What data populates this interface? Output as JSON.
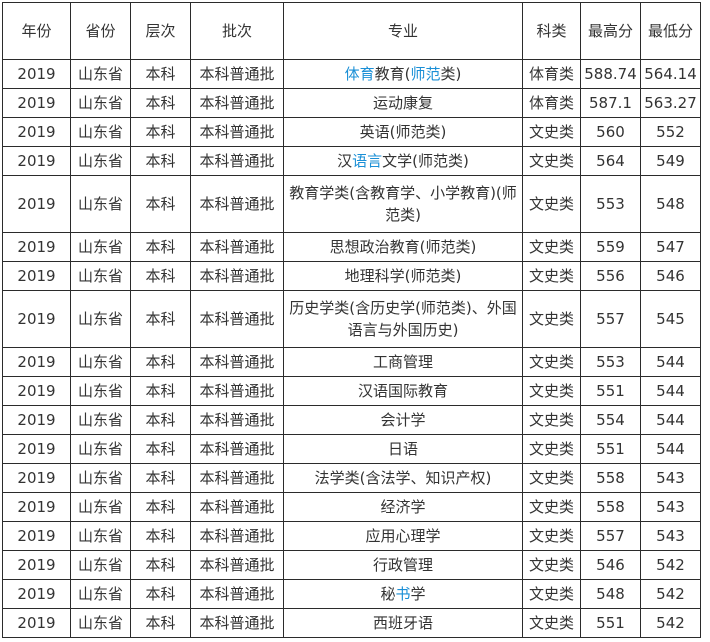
{
  "table": {
    "headers": [
      "年份",
      "省份",
      "层次",
      "批次",
      "专业",
      "科类",
      "最高分",
      "最低分"
    ],
    "rows": [
      {
        "year": "2019",
        "province": "山东省",
        "level": "本科",
        "batch": "本科普通批",
        "major": [
          {
            "t": "体育",
            "link": true
          },
          {
            "t": "教育(",
            "link": false
          },
          {
            "t": "师范",
            "link": true
          },
          {
            "t": "类)",
            "link": false
          }
        ],
        "category": "体育类",
        "max": "588.74",
        "min": "564.14"
      },
      {
        "year": "2019",
        "province": "山东省",
        "level": "本科",
        "batch": "本科普通批",
        "major": [
          {
            "t": "运动康复",
            "link": false
          }
        ],
        "category": "体育类",
        "max": "587.1",
        "min": "563.27"
      },
      {
        "year": "2019",
        "province": "山东省",
        "level": "本科",
        "batch": "本科普通批",
        "major": [
          {
            "t": "英语(师范类)",
            "link": false
          }
        ],
        "category": "文史类",
        "max": "560",
        "min": "552"
      },
      {
        "year": "2019",
        "province": "山东省",
        "level": "本科",
        "batch": "本科普通批",
        "major": [
          {
            "t": "汉",
            "link": false
          },
          {
            "t": "语言",
            "link": true
          },
          {
            "t": "文学(师范类)",
            "link": false
          }
        ],
        "category": "文史类",
        "max": "564",
        "min": "549"
      },
      {
        "year": "2019",
        "province": "山东省",
        "level": "本科",
        "batch": "本科普通批",
        "major": [
          {
            "t": "教育学类(含教育学、小学教育)(师范类)",
            "link": false
          }
        ],
        "category": "文史类",
        "max": "553",
        "min": "548",
        "tall": true
      },
      {
        "year": "2019",
        "province": "山东省",
        "level": "本科",
        "batch": "本科普通批",
        "major": [
          {
            "t": "思想政治教育(师范类)",
            "link": false
          }
        ],
        "category": "文史类",
        "max": "559",
        "min": "547"
      },
      {
        "year": "2019",
        "province": "山东省",
        "level": "本科",
        "batch": "本科普通批",
        "major": [
          {
            "t": "地理科学(师范类)",
            "link": false
          }
        ],
        "category": "文史类",
        "max": "556",
        "min": "546"
      },
      {
        "year": "2019",
        "province": "山东省",
        "level": "本科",
        "batch": "本科普通批",
        "major": [
          {
            "t": "历史学类(含历史学(师范类)、外国语言与外国历史)",
            "link": false
          }
        ],
        "category": "文史类",
        "max": "557",
        "min": "545",
        "tall": true
      },
      {
        "year": "2019",
        "province": "山东省",
        "level": "本科",
        "batch": "本科普通批",
        "major": [
          {
            "t": "工商管理",
            "link": false
          }
        ],
        "category": "文史类",
        "max": "553",
        "min": "544"
      },
      {
        "year": "2019",
        "province": "山东省",
        "level": "本科",
        "batch": "本科普通批",
        "major": [
          {
            "t": "汉语国际教育",
            "link": false
          }
        ],
        "category": "文史类",
        "max": "551",
        "min": "544"
      },
      {
        "year": "2019",
        "province": "山东省",
        "level": "本科",
        "batch": "本科普通批",
        "major": [
          {
            "t": "会计学",
            "link": false
          }
        ],
        "category": "文史类",
        "max": "554",
        "min": "544"
      },
      {
        "year": "2019",
        "province": "山东省",
        "level": "本科",
        "batch": "本科普通批",
        "major": [
          {
            "t": "日语",
            "link": false
          }
        ],
        "category": "文史类",
        "max": "551",
        "min": "544"
      },
      {
        "year": "2019",
        "province": "山东省",
        "level": "本科",
        "batch": "本科普通批",
        "major": [
          {
            "t": "法学类(含法学、知识产权)",
            "link": false
          }
        ],
        "category": "文史类",
        "max": "558",
        "min": "543"
      },
      {
        "year": "2019",
        "province": "山东省",
        "level": "本科",
        "batch": "本科普通批",
        "major": [
          {
            "t": "经济学",
            "link": false
          }
        ],
        "category": "文史类",
        "max": "558",
        "min": "543"
      },
      {
        "year": "2019",
        "province": "山东省",
        "level": "本科",
        "batch": "本科普通批",
        "major": [
          {
            "t": "应用心理学",
            "link": false
          }
        ],
        "category": "文史类",
        "max": "557",
        "min": "543"
      },
      {
        "year": "2019",
        "province": "山东省",
        "level": "本科",
        "batch": "本科普通批",
        "major": [
          {
            "t": "行政管理",
            "link": false
          }
        ],
        "category": "文史类",
        "max": "546",
        "min": "542"
      },
      {
        "year": "2019",
        "province": "山东省",
        "level": "本科",
        "batch": "本科普通批",
        "major": [
          {
            "t": "秘",
            "link": false
          },
          {
            "t": "书",
            "link": true
          },
          {
            "t": "学",
            "link": false
          }
        ],
        "category": "文史类",
        "max": "548",
        "min": "542"
      },
      {
        "year": "2019",
        "province": "山东省",
        "level": "本科",
        "batch": "本科普通批",
        "major": [
          {
            "t": "西班牙语",
            "link": false
          }
        ],
        "category": "文史类",
        "max": "551",
        "min": "542"
      }
    ]
  },
  "colors": {
    "link": "#1a8fd6",
    "text": "#333333",
    "border": "#2b2b2b"
  }
}
